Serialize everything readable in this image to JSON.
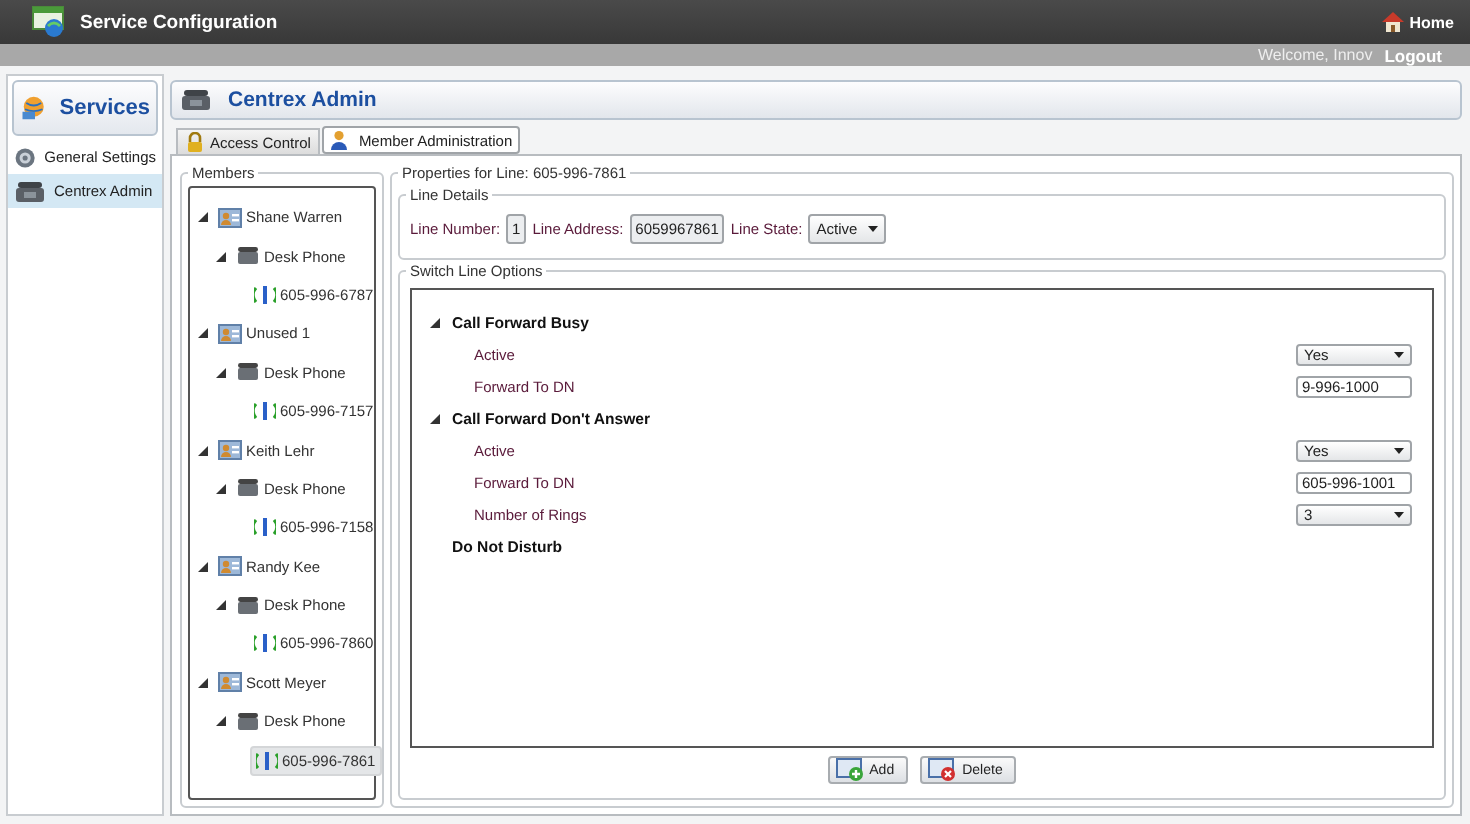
{
  "header": {
    "title": "Service Configuration",
    "home": "Home",
    "welcome": "Welcome, Innov",
    "logout": "Logout"
  },
  "sidebar": {
    "title": "Services",
    "items": [
      {
        "label": "General Settings",
        "kind": "gear",
        "selected": false
      },
      {
        "label": "Centrex Admin",
        "kind": "phone",
        "selected": true
      }
    ]
  },
  "panel": {
    "title": "Centrex Admin"
  },
  "tabs": [
    {
      "label": "Access Control",
      "kind": "lock",
      "selected": false
    },
    {
      "label": "Member Administration",
      "kind": "person",
      "selected": true
    }
  ],
  "members": {
    "title": "Members",
    "items": [
      {
        "label": "Shane Warren",
        "kind": "member",
        "expanded": true,
        "children": [
          {
            "label": "Desk Phone",
            "kind": "device",
            "expanded": true,
            "children": [
              {
                "label": "605-996-6787",
                "kind": "line",
                "selected": false
              }
            ]
          }
        ]
      },
      {
        "label": "Unused 1",
        "kind": "member",
        "expanded": true,
        "children": [
          {
            "label": "Desk Phone",
            "kind": "device",
            "expanded": true,
            "children": [
              {
                "label": "605-996-7157",
                "kind": "line",
                "selected": false
              }
            ]
          }
        ]
      },
      {
        "label": "Keith Lehr",
        "kind": "member",
        "expanded": true,
        "children": [
          {
            "label": "Desk Phone",
            "kind": "device",
            "expanded": true,
            "children": [
              {
                "label": "605-996-7158",
                "kind": "line",
                "selected": false
              }
            ]
          }
        ]
      },
      {
        "label": "Randy Kee",
        "kind": "member",
        "expanded": true,
        "children": [
          {
            "label": "Desk Phone",
            "kind": "device",
            "expanded": true,
            "children": [
              {
                "label": "605-996-7860",
                "kind": "line",
                "selected": false
              }
            ]
          }
        ]
      },
      {
        "label": "Scott Meyer",
        "kind": "member",
        "expanded": true,
        "children": [
          {
            "label": "Desk Phone",
            "kind": "device",
            "expanded": true,
            "children": [
              {
                "label": "605-996-7861",
                "kind": "line",
                "selected": true
              }
            ]
          }
        ]
      }
    ]
  },
  "properties": {
    "title": "Properties for Line: 605-996-7861",
    "line_details": {
      "title": "Line Details",
      "fields": [
        {
          "label": "Line Number:",
          "kind": "box",
          "value": "1"
        },
        {
          "label": "Line Address:",
          "kind": "box",
          "value": "6059967861"
        },
        {
          "label": "Line State:",
          "kind": "select",
          "value": "Active"
        }
      ]
    },
    "switch_options": {
      "title": "Switch Line Options",
      "groups": [
        {
          "title": "Call Forward Busy",
          "expanded": true,
          "fields": [
            {
              "label": "Active",
              "kind": "select",
              "value": "Yes"
            },
            {
              "label": "Forward To DN",
              "kind": "text",
              "value": "9-996-1000"
            }
          ]
        },
        {
          "title": "Call Forward Don't Answer",
          "expanded": true,
          "fields": [
            {
              "label": "Active",
              "kind": "select",
              "value": "Yes"
            },
            {
              "label": "Forward To DN",
              "kind": "text",
              "value": "605-996-1001"
            },
            {
              "label": "Number of Rings",
              "kind": "select",
              "value": "3"
            }
          ]
        },
        {
          "title": "Do Not Disturb"
        }
      ]
    },
    "buttons": [
      {
        "label": "Add",
        "kind": "add"
      },
      {
        "label": "Delete",
        "kind": "delete"
      }
    ]
  }
}
